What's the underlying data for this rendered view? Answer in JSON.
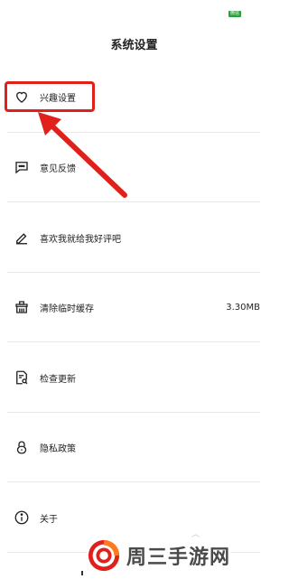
{
  "status_bar": {
    "badge": "微信"
  },
  "page": {
    "title": "系统设置"
  },
  "menu": {
    "items": [
      {
        "label": "兴趣设置",
        "icon": "heart-icon",
        "value": ""
      },
      {
        "label": "意见反馈",
        "icon": "feedback-icon",
        "value": ""
      },
      {
        "label": "喜欢我就给我好评吧",
        "icon": "pen-icon",
        "value": ""
      },
      {
        "label": "清除临时缓存",
        "icon": "basket-icon",
        "value": "3.30MB"
      },
      {
        "label": "检查更新",
        "icon": "document-search-icon",
        "value": ""
      },
      {
        "label": "隐私政策",
        "icon": "lock-icon",
        "value": ""
      },
      {
        "label": "关于",
        "icon": "info-icon",
        "value": ""
      }
    ]
  },
  "overlay": {
    "highlight_color": "#e0211b"
  },
  "watermark": {
    "text": "周三手游网"
  }
}
